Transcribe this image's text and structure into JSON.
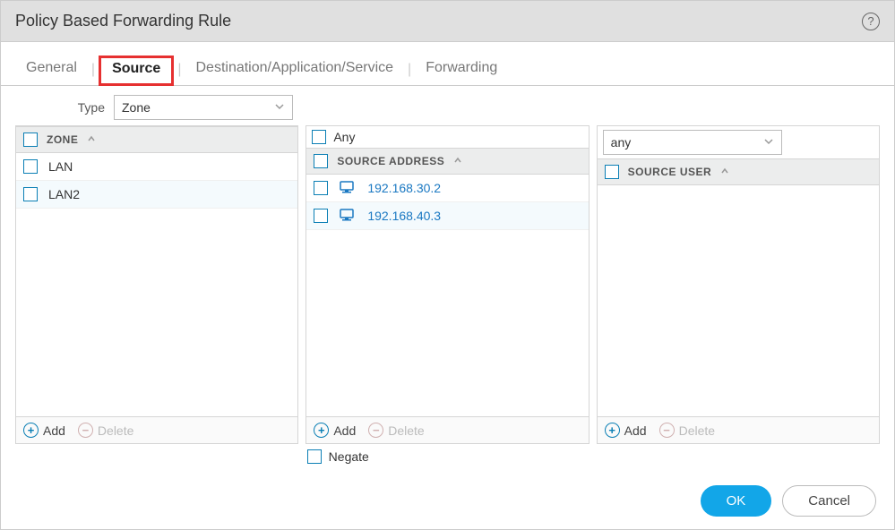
{
  "header": {
    "title": "Policy Based Forwarding Rule"
  },
  "tabs": {
    "general": "General",
    "source": "Source",
    "dest": "Destination/Application/Service",
    "forwarding": "Forwarding"
  },
  "type": {
    "label": "Type",
    "value": "Zone"
  },
  "zone": {
    "header": "ZONE",
    "rows": [
      "LAN",
      "LAN2"
    ],
    "add": "Add",
    "delete": "Delete"
  },
  "sourceAddress": {
    "anyLabel": "Any",
    "header": "SOURCE ADDRESS",
    "rows": [
      "192.168.30.2",
      "192.168.40.3"
    ],
    "add": "Add",
    "delete": "Delete",
    "negate": "Negate"
  },
  "sourceUser": {
    "selectValue": "any",
    "header": "SOURCE USER",
    "add": "Add",
    "delete": "Delete"
  },
  "footer": {
    "ok": "OK",
    "cancel": "Cancel"
  }
}
